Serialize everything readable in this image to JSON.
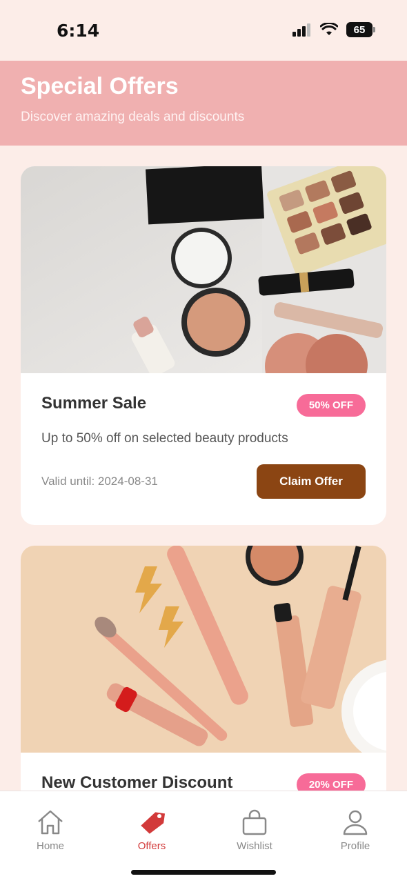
{
  "status": {
    "time": "6:14",
    "battery": "65"
  },
  "header": {
    "title": "Special Offers",
    "subtitle": "Discover amazing deals and discounts"
  },
  "offers": [
    {
      "title": "Summer Sale",
      "badge": "50% OFF",
      "description": "Up to 50% off on selected beauty products",
      "valid": "Valid until: 2024-08-31",
      "button": "Claim Offer"
    },
    {
      "title": "New Customer Discount",
      "badge": "20% OFF"
    }
  ],
  "tabs": [
    {
      "label": "Home",
      "icon": "home-icon"
    },
    {
      "label": "Offers",
      "icon": "tag-icon"
    },
    {
      "label": "Wishlist",
      "icon": "bag-icon"
    },
    {
      "label": "Profile",
      "icon": "person-icon"
    }
  ],
  "colors": {
    "header": "#f0b0b0",
    "badge": "#f76b98",
    "button": "#8b4513",
    "active_tab": "#d23a3a",
    "background": "#fcede8"
  }
}
